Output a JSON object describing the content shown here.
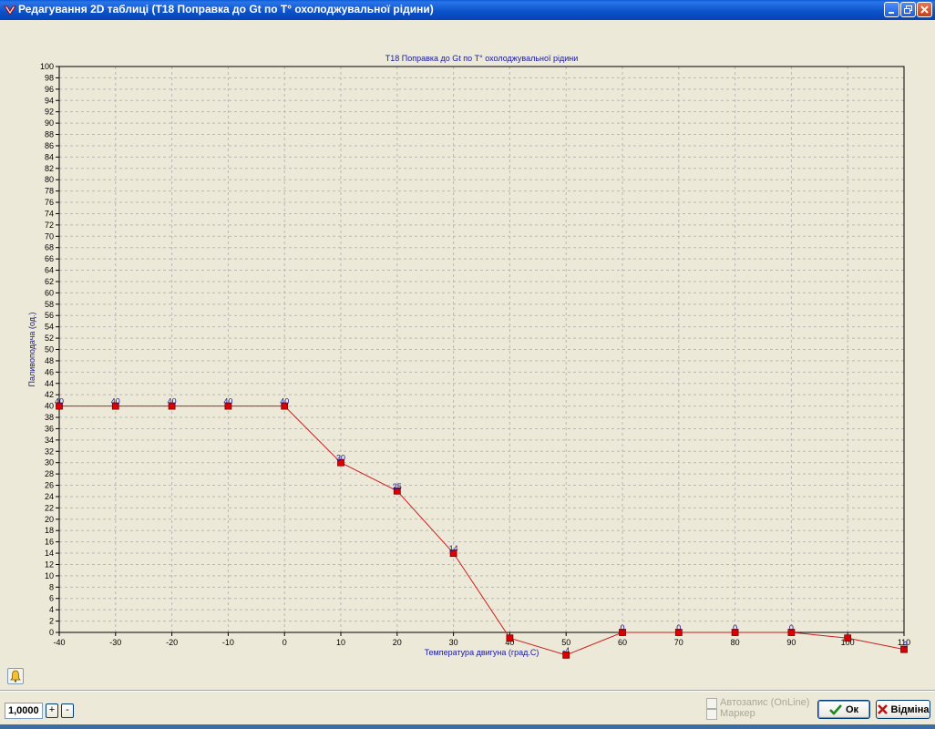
{
  "window": {
    "title": "Редагування 2D таблиці (T18 Поправка до Gt по T° охолоджувальної рідини)"
  },
  "controls": {
    "step_value": "1,0000",
    "plus_label": "+",
    "minus_label": "-",
    "autosave_label": "Автозапис (OnLine)",
    "marker_label": "Маркер",
    "ok_label": "Ок",
    "cancel_label": "Відміна"
  },
  "colors": {
    "line": "#cc2020",
    "marker": "#dd0000",
    "text": "#1a1a9a",
    "grid": "#b8b8b8"
  },
  "chart_data": {
    "type": "line",
    "title": "T18 Поправка до Gt по T° охолоджувальної рідини",
    "xlabel": "Температура двигуна (град.С)",
    "ylabel": "Паливоподача (од.)",
    "x": [
      -40,
      -30,
      -20,
      -10,
      0,
      10,
      20,
      30,
      40,
      50,
      60,
      70,
      80,
      90,
      100,
      110
    ],
    "series": [
      {
        "values": [
          40,
          40,
          40,
          40,
          40,
          30,
          25,
          14,
          -1,
          -4,
          0,
          0,
          0,
          0,
          -1,
          -3
        ]
      }
    ],
    "point_labels": [
      "40",
      "40",
      "40",
      "40",
      "40",
      "30",
      "25",
      "14",
      "",
      "-4",
      "0",
      "0",
      "0",
      "0",
      "",
      "-3"
    ],
    "xticks": [
      "-40",
      "-30",
      "-20",
      "-10",
      "0",
      "10",
      "20",
      "30",
      "40",
      "50",
      "60",
      "70",
      "80",
      "90",
      "100",
      "110"
    ],
    "xlim": [
      -40,
      110
    ],
    "ylim": [
      0,
      100
    ],
    "ytick_step": 2,
    "grid": true,
    "legend": "none"
  }
}
